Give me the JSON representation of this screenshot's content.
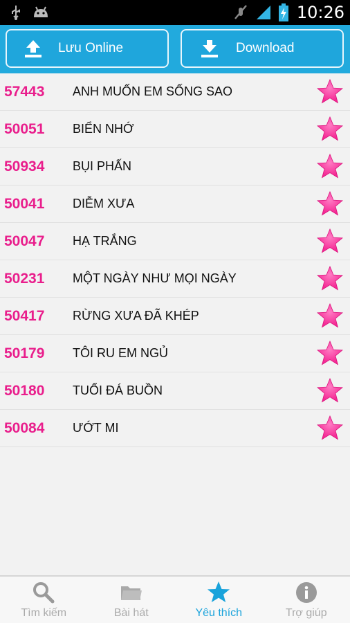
{
  "status_bar": {
    "time": "10:26",
    "icons": [
      "usb-icon",
      "android-icon",
      "mute-icon",
      "signal-icon",
      "battery-charging-icon"
    ]
  },
  "actions": {
    "upload_label": "Lưu Online",
    "download_label": "Download"
  },
  "songs": [
    {
      "code": "57443",
      "title": "ANH MUỐN EM SỐNG SAO"
    },
    {
      "code": "50051",
      "title": "BIỂN NHỚ"
    },
    {
      "code": "50934",
      "title": "BỤI PHẤN"
    },
    {
      "code": "50041",
      "title": "DIỄM XƯA"
    },
    {
      "code": "50047",
      "title": "HẠ TRẮNG"
    },
    {
      "code": "50231",
      "title": "MỘT NGÀY NHƯ MỌI NGÀY"
    },
    {
      "code": "50417",
      "title": "RỪNG XƯA ĐÃ KHÉP"
    },
    {
      "code": "50179",
      "title": "TÔI RU EM NGỦ"
    },
    {
      "code": "50180",
      "title": "TUỔI ĐÁ BUỒN"
    },
    {
      "code": "50084",
      "title": "ƯỚT MI"
    }
  ],
  "tabs": [
    {
      "label": "Tìm kiếm",
      "icon": "search-icon"
    },
    {
      "label": "Bài hát",
      "icon": "folder-icon"
    },
    {
      "label": "Yêu thích",
      "icon": "star-icon",
      "active": true
    },
    {
      "label": "Trợ giúp",
      "icon": "info-icon"
    }
  ],
  "colors": {
    "accent": "#22aadd",
    "code_pink": "#e91e8c",
    "star_pink": "#ff3aa3",
    "tab_active": "#1aa3db",
    "tab_inactive": "#aaaaaa"
  }
}
